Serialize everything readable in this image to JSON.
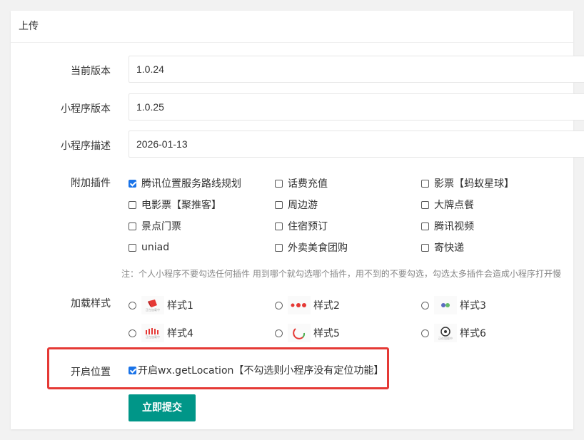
{
  "card": {
    "title": "上传"
  },
  "form": {
    "current_version": {
      "label": "当前版本",
      "value": "1.0.24"
    },
    "mp_version": {
      "label": "小程序版本",
      "value": "1.0.25"
    },
    "mp_desc": {
      "label": "小程序描述",
      "value": "2026-01-13"
    },
    "plugins": {
      "label": "附加插件",
      "items": [
        {
          "label": "腾讯位置服务路线规划",
          "checked": true
        },
        {
          "label": "话费充值",
          "checked": false
        },
        {
          "label": "影票【蚂蚁星球】",
          "checked": false
        },
        {
          "label": "电影票【聚推客】",
          "checked": false
        },
        {
          "label": "周边游",
          "checked": false
        },
        {
          "label": "大牌点餐",
          "checked": false
        },
        {
          "label": "景点门票",
          "checked": false
        },
        {
          "label": "住宿预订",
          "checked": false
        },
        {
          "label": "腾讯视频",
          "checked": false
        },
        {
          "label": "uniad",
          "checked": false
        },
        {
          "label": "外卖美食团购",
          "checked": false
        },
        {
          "label": "寄快递",
          "checked": false
        }
      ],
      "note": "注：个人小程序不要勾选任何插件 用到哪个就勾选哪个插件，用不到的不要勾选，勾选太多插件会造成小程序打开慢"
    },
    "loading_style": {
      "label": "加载样式",
      "options": [
        {
          "label": "样式1",
          "icon": "red-cube-icon",
          "caption": "正在加载中"
        },
        {
          "label": "样式2",
          "icon": "red-dots-icon",
          "caption": ""
        },
        {
          "label": "样式3",
          "icon": "blue-green-dots-icon",
          "caption": ""
        },
        {
          "label": "样式4",
          "icon": "red-bars-icon",
          "caption": "正在加载中"
        },
        {
          "label": "样式5",
          "icon": "arc-spinner-icon",
          "caption": ""
        },
        {
          "label": "样式6",
          "icon": "ring-dot-icon",
          "caption": "正在加载中"
        }
      ]
    },
    "location": {
      "label": "开启位置",
      "checkbox_label": "开启wx.getLocation【不勾选则小程序没有定位功能】",
      "checked": true
    },
    "submit_label": "立即提交"
  },
  "colors": {
    "primary": "#009688",
    "checkbox": "#1a73e8",
    "highlight": "#e53935"
  }
}
